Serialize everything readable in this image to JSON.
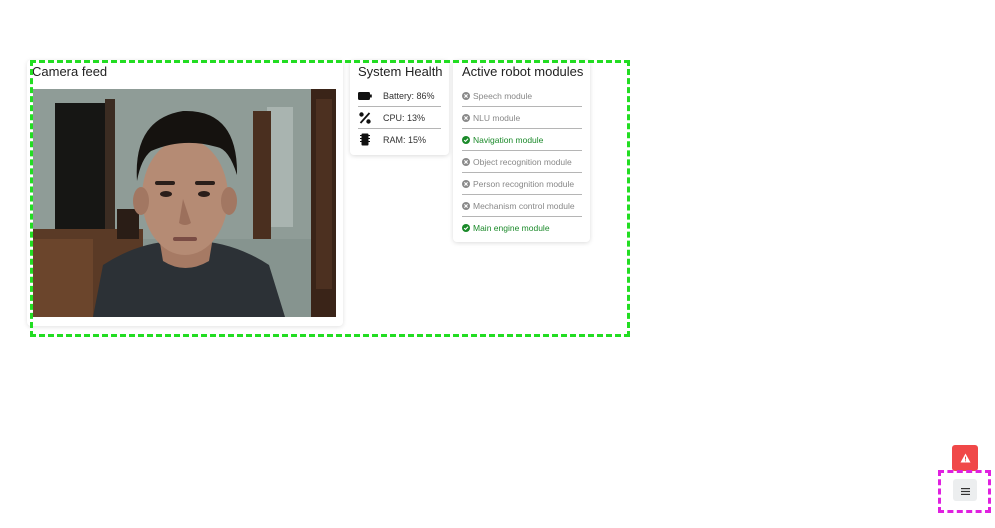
{
  "camera": {
    "title": "Camera feed"
  },
  "health": {
    "title": "System Health",
    "items": [
      {
        "label": "Battery: 86%",
        "icon": "battery-icon"
      },
      {
        "label": "CPU: 13%",
        "icon": "percent-icon"
      },
      {
        "label": "RAM: 15%",
        "icon": "memory-icon"
      }
    ]
  },
  "modules": {
    "title": "Active robot modules",
    "items": [
      {
        "label": "Speech module",
        "status": "inactive",
        "icon": "close-circle-icon"
      },
      {
        "label": "NLU module",
        "status": "inactive",
        "icon": "close-circle-icon"
      },
      {
        "label": "Navigation module",
        "status": "active",
        "icon": "check-circle-icon"
      },
      {
        "label": "Object recognition module",
        "status": "inactive",
        "icon": "close-circle-icon"
      },
      {
        "label": "Person recognition module",
        "status": "inactive",
        "icon": "close-circle-icon"
      },
      {
        "label": "Mechanism control module",
        "status": "inactive",
        "icon": "close-circle-icon"
      },
      {
        "label": "Main engine module",
        "status": "active",
        "icon": "check-circle-icon"
      }
    ]
  },
  "fab": {
    "alert_icon": "warning-icon",
    "menu_icon": "menu-icon"
  },
  "colors": {
    "active": "#1b8a2a",
    "inactive": "#888888",
    "alert": "#f04848",
    "highlight_green": "#22dd22",
    "highlight_magenta": "#e020e0"
  }
}
